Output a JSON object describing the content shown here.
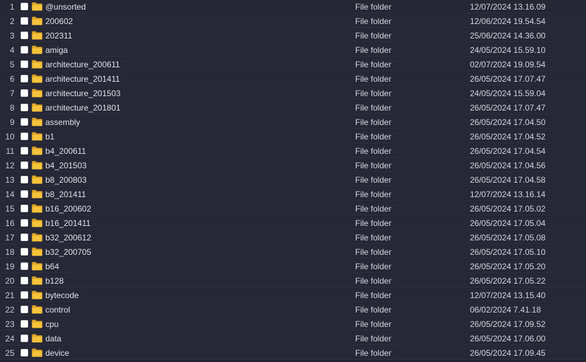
{
  "icon": "folder-icon",
  "folder_color": "#f5c33b",
  "rows": [
    {
      "num": "1",
      "name": "@unsorted",
      "type": "File folder",
      "date": "12/07/2024 13.16.09"
    },
    {
      "num": "2",
      "name": "200602",
      "type": "File folder",
      "date": "12/06/2024 19.54.54"
    },
    {
      "num": "3",
      "name": "202311",
      "type": "File folder",
      "date": "25/06/2024 14.36.00"
    },
    {
      "num": "4",
      "name": "amiga",
      "type": "File folder",
      "date": "24/05/2024 15.59.10"
    },
    {
      "num": "5",
      "name": "architecture_200611",
      "type": "File folder",
      "date": "02/07/2024 19.09.54"
    },
    {
      "num": "6",
      "name": "architecture_201411",
      "type": "File folder",
      "date": "26/05/2024 17.07.47"
    },
    {
      "num": "7",
      "name": "architecture_201503",
      "type": "File folder",
      "date": "24/05/2024 15.59.04"
    },
    {
      "num": "8",
      "name": "architecture_201801",
      "type": "File folder",
      "date": "26/05/2024 17.07.47"
    },
    {
      "num": "9",
      "name": "assembly",
      "type": "File folder",
      "date": "26/05/2024 17.04.50"
    },
    {
      "num": "10",
      "name": "b1",
      "type": "File folder",
      "date": "26/05/2024 17.04.52"
    },
    {
      "num": "11",
      "name": "b4_200611",
      "type": "File folder",
      "date": "26/05/2024 17.04.54"
    },
    {
      "num": "12",
      "name": "b4_201503",
      "type": "File folder",
      "date": "26/05/2024 17.04.56"
    },
    {
      "num": "13",
      "name": "b8_200803",
      "type": "File folder",
      "date": "26/05/2024 17.04.58"
    },
    {
      "num": "14",
      "name": "b8_201411",
      "type": "File folder",
      "date": "12/07/2024 13.16.14"
    },
    {
      "num": "15",
      "name": "b16_200602",
      "type": "File folder",
      "date": "26/05/2024 17.05.02"
    },
    {
      "num": "16",
      "name": "b16_201411",
      "type": "File folder",
      "date": "26/05/2024 17.05.04"
    },
    {
      "num": "17",
      "name": "b32_200612",
      "type": "File folder",
      "date": "26/05/2024 17.05.08"
    },
    {
      "num": "18",
      "name": "b32_200705",
      "type": "File folder",
      "date": "26/05/2024 17.05.10"
    },
    {
      "num": "19",
      "name": "b64",
      "type": "File folder",
      "date": "26/05/2024 17.05.20"
    },
    {
      "num": "20",
      "name": "b128",
      "type": "File folder",
      "date": "26/05/2024 17.05.22"
    },
    {
      "num": "21",
      "name": "bytecode",
      "type": "File folder",
      "date": "12/07/2024 13.15.40"
    },
    {
      "num": "22",
      "name": "control",
      "type": "File folder",
      "date": "06/02/2024 7.41.18"
    },
    {
      "num": "23",
      "name": "cpu",
      "type": "File folder",
      "date": "26/05/2024 17.09.52"
    },
    {
      "num": "24",
      "name": "data",
      "type": "File folder",
      "date": "26/05/2024 17.06.00"
    },
    {
      "num": "25",
      "name": "device",
      "type": "File folder",
      "date": "26/05/2024 17.09.45"
    }
  ]
}
